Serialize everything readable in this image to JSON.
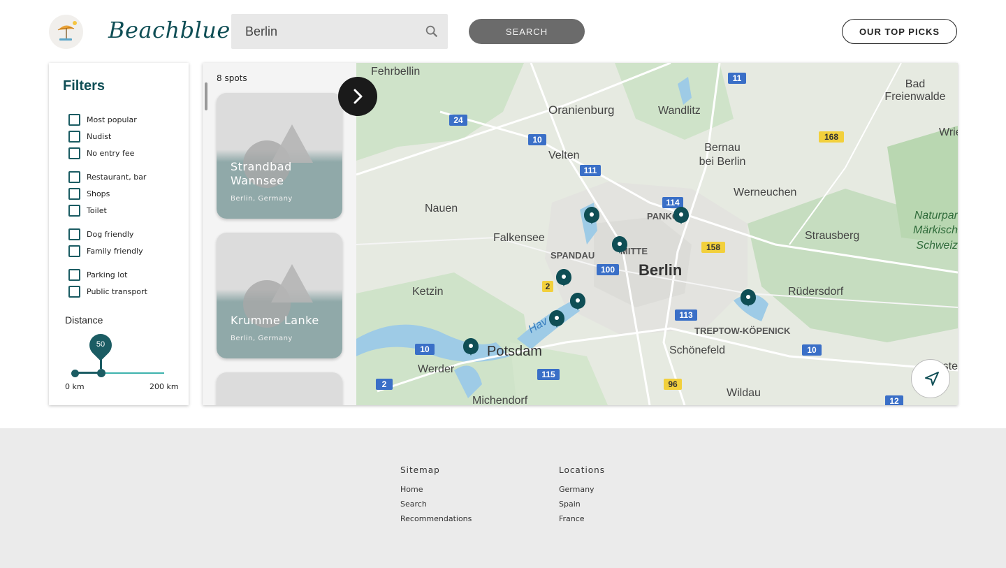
{
  "header": {
    "brand": "Beachblue",
    "search_value": "Berlin",
    "search_button": "SEARCH",
    "top_picks_button": "OUR TOP PICKS"
  },
  "filters": {
    "title": "Filters",
    "items": [
      {
        "label": "Most popular",
        "checked": false
      },
      {
        "label": "Nudist",
        "checked": false
      },
      {
        "label": "No entry fee",
        "checked": false
      },
      {
        "label": "Restaurant, bar",
        "checked": false
      },
      {
        "label": "Shops",
        "checked": false
      },
      {
        "label": "Toilet",
        "checked": false
      },
      {
        "label": "Dog friendly",
        "checked": false
      },
      {
        "label": "Family friendly",
        "checked": false
      },
      {
        "label": "Parking lot",
        "checked": false
      },
      {
        "label": "Public transport",
        "checked": false
      }
    ],
    "distance": {
      "label": "Distance",
      "value": "50",
      "min_label": "0 km",
      "max_label": "200 km"
    }
  },
  "results": {
    "count_text": "8 spots",
    "cards": [
      {
        "title": "Strandbad Wannsee",
        "subtitle": "Berlin, Germany"
      },
      {
        "title": "Krumme Lanke",
        "subtitle": "Berlin, Germany"
      }
    ]
  },
  "map": {
    "labels": [
      "Fehrbellin",
      "Oranienburg",
      "Wandlitz",
      "Bad Freienwalde",
      "Velten",
      "Bernau bei Berlin",
      "Wriez",
      "Nauen",
      "Werneuchen",
      "Naturpar Märkisch Schweiz",
      "Falkensee",
      "SPANDAU",
      "MITTE",
      "Berlin",
      "PANKOW",
      "Strausberg",
      "Ketzin",
      "Rüdersdorf",
      "TREPTOW-KÖPENICK",
      "Potsdam",
      "Schönefeld",
      "Werder",
      "Michendorf",
      "Wildau",
      "Fürste"
    ],
    "route_shields": [
      "11",
      "24",
      "10",
      "168",
      "111",
      "114",
      "158",
      "100",
      "2",
      "113",
      "10",
      "115",
      "96",
      "10",
      "2",
      "12"
    ],
    "marker_count": 8,
    "accent": "#0f4e55"
  },
  "footer": {
    "sitemap": {
      "heading": "Sitemap",
      "links": [
        "Home",
        "Search",
        "Recommendations"
      ]
    },
    "locations": {
      "heading": "Locations",
      "links": [
        "Germany",
        "Spain",
        "France"
      ]
    }
  }
}
